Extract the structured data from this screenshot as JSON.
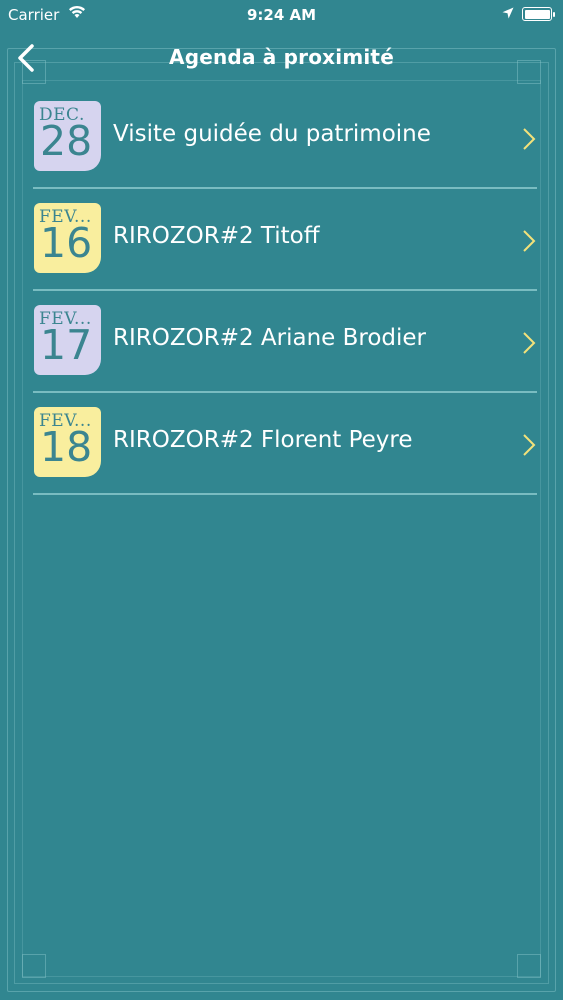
{
  "status_bar": {
    "carrier": "Carrier",
    "time": "9:24 AM"
  },
  "nav": {
    "title": "Agenda à proximité",
    "back_icon": "chevron-left-icon"
  },
  "colors": {
    "background": "#318690",
    "badge_lavender": "#d6d4ef",
    "badge_yellow": "#f9ee9e",
    "chevron": "#f3e27a",
    "date_text": "#3b8590"
  },
  "events": [
    {
      "month": "DEC.",
      "day": "28",
      "title": "Visite guidée du patrimoine",
      "badge_color": "lavender"
    },
    {
      "month": "FEV...",
      "day": "16",
      "title": "RIROZOR#2 Titoff",
      "badge_color": "yellow"
    },
    {
      "month": "FEV...",
      "day": "17",
      "title": "RIROZOR#2 Ariane Brodier",
      "badge_color": "lavender"
    },
    {
      "month": "FEV...",
      "day": "18",
      "title": "RIROZOR#2 Florent Peyre",
      "badge_color": "yellow"
    }
  ]
}
